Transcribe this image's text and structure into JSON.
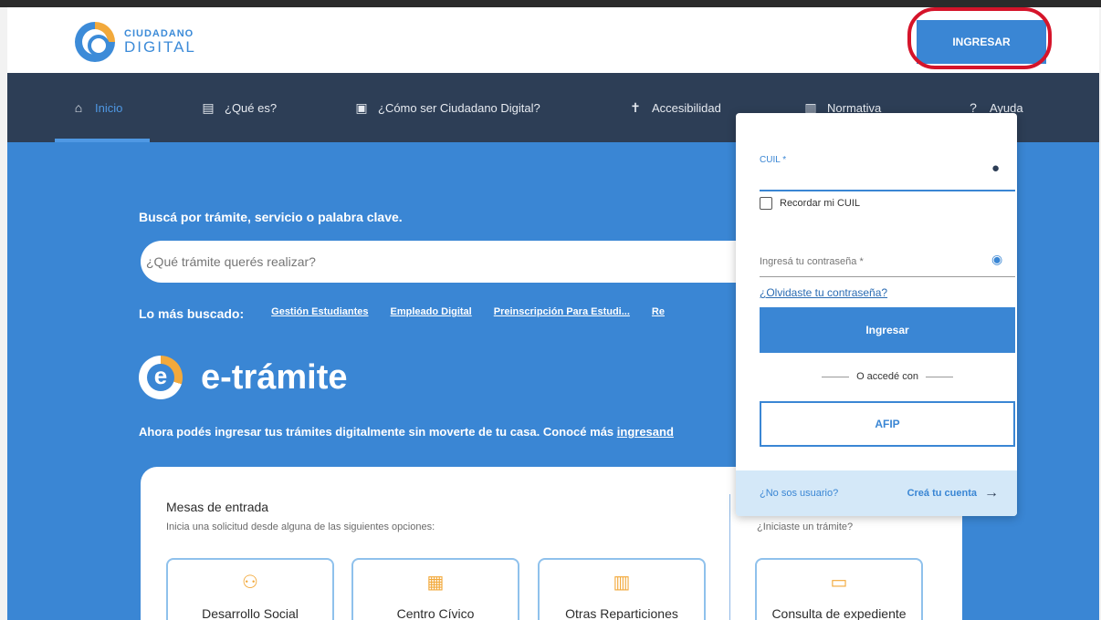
{
  "brand": {
    "line1": "CIUDADANO",
    "line2": "DIGITAL"
  },
  "header": {
    "login_button": "INGRESAR"
  },
  "nav": {
    "items": [
      {
        "label": "Inicio",
        "icon": "home-icon"
      },
      {
        "label": "¿Qué es?",
        "icon": "list-icon"
      },
      {
        "label": "¿Cómo ser Ciudadano Digital?",
        "icon": "id-card-icon"
      },
      {
        "label": "Accesibilidad",
        "icon": "accessibility-icon"
      },
      {
        "label": "Normativa",
        "icon": "document-icon"
      },
      {
        "label": "Ayuda",
        "icon": "help-icon"
      }
    ]
  },
  "hero": {
    "search_label": "Buscá por trámite, servicio o palabra clave.",
    "search_placeholder": "¿Qué trámite querés realizar?",
    "popular_label": "Lo más buscado:",
    "popular": [
      "Gestión Estudiantes",
      "Empleado Digital",
      "Preinscripción Para Estudi...",
      "Re"
    ],
    "etramite_title": "e-trámite",
    "description": "Ahora podés ingresar tus trámites digitalmente sin moverte de tu casa. Conocé más ",
    "description_link": "ingresand"
  },
  "card": {
    "title": "Mesas de entrada",
    "subtitle": "Inicia una solicitud desde alguna de las siguientes opciones:",
    "side_subtitle": "¿Iniciaste un trámite?",
    "tiles": [
      "Desarrollo Social",
      "Centro Cívico",
      "Otras Reparticiones",
      "Consulta de expediente"
    ]
  },
  "login": {
    "cuil_label": "CUIL *",
    "remember": "Recordar mi CUIL",
    "password_placeholder": "Ingresá tu contraseña *",
    "forgot": "¿Olvidaste tu contraseña?",
    "submit": "Ingresar",
    "or_text": "O accedé con",
    "afip": "AFIP",
    "no_user": "¿No sos usuario?",
    "create_account": "Creá tu cuenta"
  }
}
